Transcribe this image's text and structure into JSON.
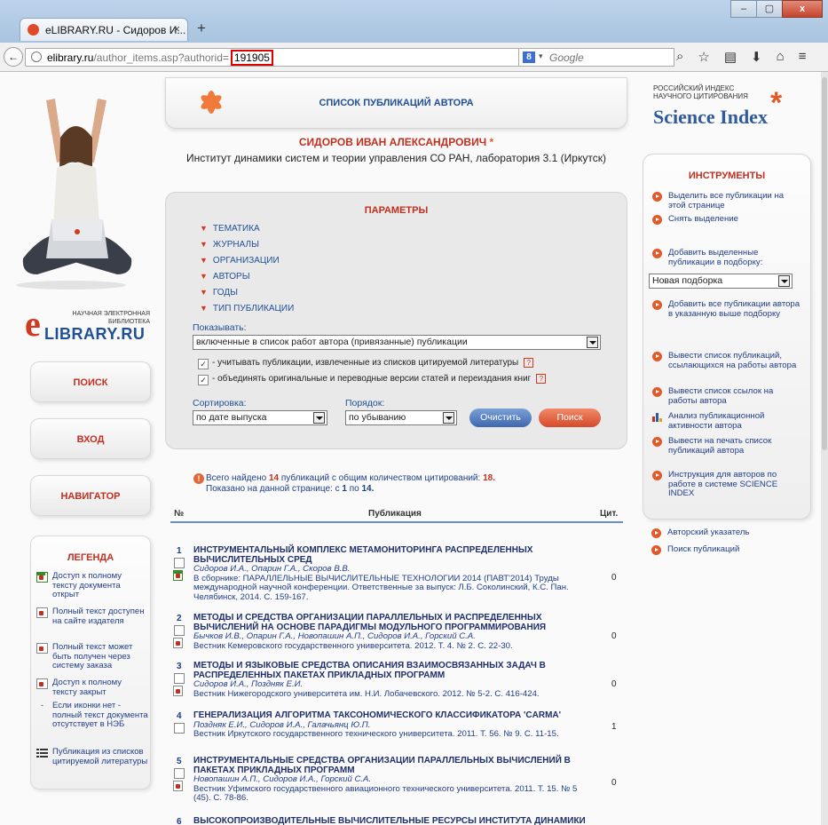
{
  "browser": {
    "tab_title": "eLIBRARY.RU - Сидоров И...",
    "tab_close": "×",
    "new_tab": "+",
    "win_min": "–",
    "win_max": "▢",
    "win_close": "x",
    "back": "←",
    "url_host": "elibrary.ru",
    "url_path": "/author_items.asp?authorid=",
    "url_id": "191905",
    "url_icons": "▿ C",
    "search_engine": "8",
    "search_placeholder": "Google",
    "nav_icons": [
      "⌕",
      "☆",
      "▤",
      "⬇",
      "⌂",
      "≡"
    ]
  },
  "site": {
    "brand_small": "НАУЧНАЯ ЭЛЕКТРОННАЯ БИБЛИОТЕКА",
    "brand_e": "e",
    "brand_name": "LIBRARY.RU",
    "page_title": "СПИСОК ПУБЛИКАЦИЙ АВТОРА",
    "si_small": "РОССИЙСКИЙ ИНДЕКС НАУЧНОГО ЦИТИРОВАНИЯ",
    "si_name": "Science Index",
    "author_name": "СИДОРОВ ИВАН АЛЕКСАНДРОВИЧ",
    "author_star": "*",
    "author_inst": "Институт динамики систем и теории управления СО РАН, лаборатория 3.1 (Иркутск)"
  },
  "left_nav": {
    "search": "ПОИСК",
    "login": "ВХОД",
    "navigator": "НАВИГАТОР"
  },
  "legend": {
    "title": "ЛЕГЕНДА",
    "items": [
      "Доступ к полному тексту документа открыт",
      "Полный текст доступен на сайте издателя",
      "Полный текст может быть получен через систему заказа",
      "Доступ к полному тексту закрыт",
      "Если иконки нет - полный текст документа отсутствует в НЭБ",
      "Публикация из списков цитируемой литературы"
    ],
    "dash": "-"
  },
  "params": {
    "title": "ПАРАМЕТРЫ",
    "facets": [
      "ТЕМАТИКА",
      "ЖУРНАЛЫ",
      "ОРГАНИЗАЦИИ",
      "АВТОРЫ",
      "ГОДЫ",
      "ТИП ПУБЛИКАЦИИ"
    ],
    "show_label": "Показывать:",
    "show_value": "включенные в список работ автора (привязанные) публикации",
    "check1": "- учитывать публикации, извлеченные из списков цитируемой литературы",
    "check2": "- объединять оригинальные и переводные версии статей и переиздания книг",
    "check_mark": "✓",
    "help": "?",
    "sort_label": "Сортировка:",
    "sort_value": "по дате выпуска",
    "order_label": "Порядок:",
    "order_value": "по убыванию",
    "clear": "Очистить",
    "search": "Поиск"
  },
  "summary": {
    "info_icon": "!",
    "line1_a": "Всего найдено ",
    "count": "14",
    "line1_b": " публикаций с общим количеством цитирований: ",
    "citations": "18.",
    "line2_a": "Показано на данной странице: с ",
    "from": "1",
    "line2_b": " по ",
    "to": "14."
  },
  "table": {
    "col_num": "№",
    "col_pub": "Публикация",
    "col_cit": "Цит.",
    "rows": [
      {
        "n": "1",
        "title": "ИНСТРУМЕНТАЛЬНЫЙ КОМПЛЕКС МЕТАМОНИТОРИНГА РАСПРЕДЕЛЕННЫХ ВЫЧИСЛИТЕЛЬНЫХ СРЕД",
        "authors": "Сидоров И.А., Опарин Г.А., Скоров В.В.",
        "source": "В сборнике: ПАРАЛЛЕЛЬНЫЕ ВЫЧИСЛИТЕЛЬНЫЕ ТЕХНОЛОГИИ 2014 (ПАВТ'2014) Труды международной научной конференции. Ответственные за выпуск: Л.Б. Соколинский, К.С. Пан. Челябинск, 2014. С. 159-167.",
        "cit": "0"
      },
      {
        "n": "2",
        "title": "МЕТОДЫ И СРЕДСТВА ОРГАНИЗАЦИИ ПАРАЛЛЕЛЬНЫХ И РАСПРЕДЕЛЕННЫХ ВЫЧИСЛЕНИЙ НА ОСНОВЕ ПАРАДИГМЫ МОДУЛЬНОГО ПРОГРАММИРОВАНИЯ",
        "authors": "Бычков И.В., Опарин Г.А., Новопашин А.П., Сидоров И.А., Горский С.А.",
        "source": "Вестник Кемеровского государственного университета. 2012. Т. 4. № 2. С. 22-30.",
        "cit": "0"
      },
      {
        "n": "3",
        "title": "МЕТОДЫ И ЯЗЫКОВЫЕ СРЕДСТВА ОПИСАНИЯ ВЗАИМОСВЯЗАННЫХ ЗАДАЧ В РАСПРЕДЕЛЕННЫХ ПАКЕТАХ ПРИКЛАДНЫХ ПРОГРАММ",
        "authors": "Сидоров И.А., Поздняк Е.И.",
        "source": "Вестник Нижегородского университета им. Н.И. Лобачевского. 2012. № 5-2. С. 416-424.",
        "cit": "0"
      },
      {
        "n": "4",
        "title": "ГЕНЕРАЛИЗАЦИЯ АЛГОРИТМА ТАКСОНОМИЧЕСКОГО КЛАССИФИКАТОРА 'CARMA'",
        "authors": "Поздняк Е.И., Сидоров И.А., Галачьянц Ю.П.",
        "source": "Вестник Иркутского государственного технического университета. 2011. Т. 56. № 9. С. 11-15.",
        "cit": "1"
      },
      {
        "n": "5",
        "title": "ИНСТРУМЕНТАЛЬНЫЕ СРЕДСТВА ОРГАНИЗАЦИИ ПАРАЛЛЕЛЬНЫХ ВЫЧИСЛЕНИЙ В ПАКЕТАХ ПРИКЛАДНЫХ ПРОГРАММ",
        "authors": "Новопашин А.П., Сидоров И.А., Горский С.А.",
        "source": "Вестник Уфимского государственного авиационного технического университета. 2011. Т. 15. № 5 (45). С. 78-86.",
        "cit": "0"
      },
      {
        "n": "6",
        "title": "ВЫСОКОПРОИЗВОДИТЕЛЬНЫЕ ВЫЧИСЛИТЕЛЬНЫЕ РЕСУРСЫ ИНСТИТУТА ДИНАМИКИ",
        "authors": "",
        "source": "",
        "cit": ""
      }
    ]
  },
  "tools": {
    "title": "ИНСТРУМЕНТЫ",
    "select_all": "Выделить все публикации на этой странице",
    "deselect": "Снять выделение",
    "add_selected": "Добавить выделенные публикации в подборку:",
    "collection_value": "Новая подборка",
    "add_all": "Добавить все публикации автора в указанную выше подборку",
    "citing_list": "Вывести список публикаций, ссылающихся на работы автора",
    "refs_list": "Вывести список ссылок на работы автора",
    "analysis": "Анализ публикационной активности автора",
    "print": "Вывести на печать список публикаций автора",
    "manual": "Инструкция для авторов по работе в системе SCIENCE INDEX",
    "author_index": "Авторский указатель",
    "pub_search": "Поиск публикаций"
  }
}
